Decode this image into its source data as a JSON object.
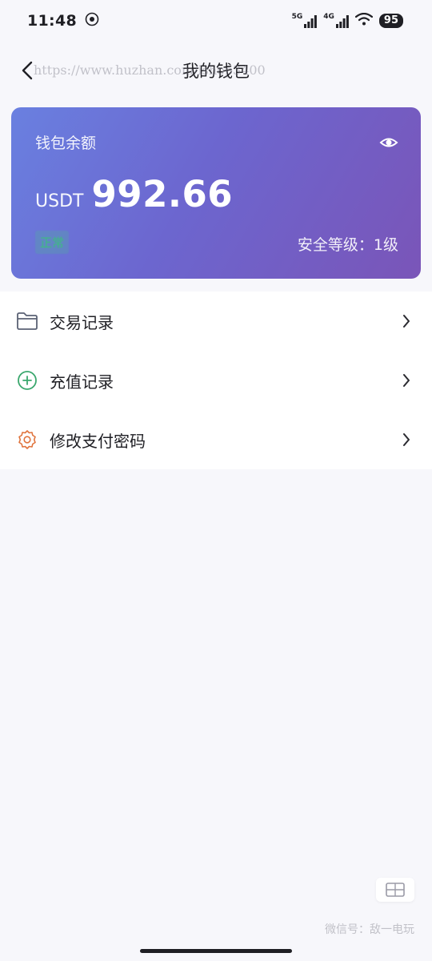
{
  "status_bar": {
    "time": "11:48",
    "network_1": "5G",
    "network_2": "4G",
    "battery": "95"
  },
  "nav": {
    "title": "我的钱包",
    "back_icon": "chevron-left-icon"
  },
  "watermark": {
    "text": "https://www.huzhan.com/ishop3400"
  },
  "wallet": {
    "label": "钱包余额",
    "currency": "USDT",
    "amount": "992.66",
    "status": "正常",
    "security": "安全等级：1级",
    "status_color": "#39c17a",
    "gradient_start": "#6a80e0",
    "gradient_end": "#7a55b8"
  },
  "menu": {
    "items": [
      {
        "label": "交易记录",
        "icon": "folder-icon",
        "color": "#5b6275"
      },
      {
        "label": "充值记录",
        "icon": "plus-circle-icon",
        "color": "#3aa76d"
      },
      {
        "label": "修改支付密码",
        "icon": "gear-icon",
        "color": "#e0733c"
      }
    ]
  },
  "corner_watermark": {
    "text": "微信号：敌一电玩"
  }
}
